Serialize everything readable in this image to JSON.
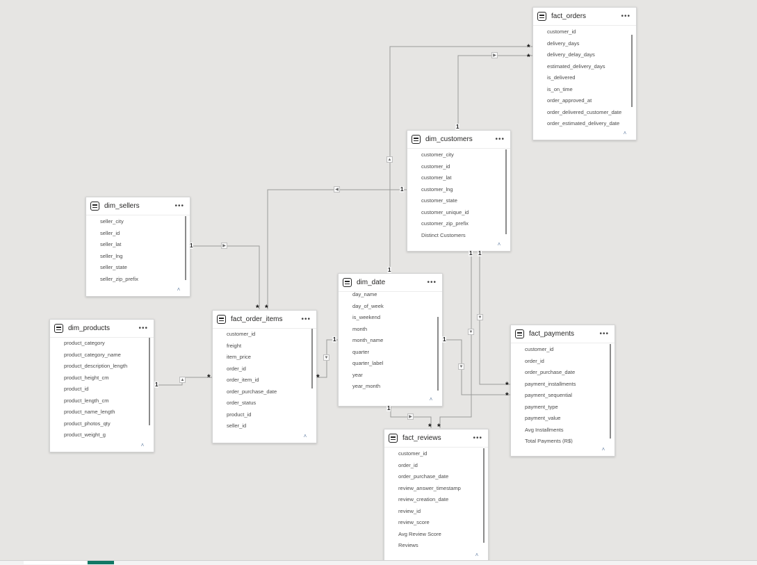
{
  "tables": [
    {
      "id": "fact_orders",
      "title": "fact_orders",
      "fields": [
        "customer_id",
        "delivery_days",
        "delivery_delay_days",
        "estimated_delivery_days",
        "is_delivered",
        "is_on_time",
        "order_approved_at",
        "order_delivered_customer_date",
        "order_estimated_delivery_date"
      ]
    },
    {
      "id": "dim_customers",
      "title": "dim_customers",
      "fields": [
        "customer_city",
        "customer_id",
        "customer_lat",
        "customer_lng",
        "customer_state",
        "customer_unique_id",
        "customer_zip_prefix",
        "Distinct Customers"
      ]
    },
    {
      "id": "dim_sellers",
      "title": "dim_sellers",
      "fields": [
        "seller_city",
        "seller_id",
        "seller_lat",
        "seller_lng",
        "seller_state",
        "seller_zip_prefix"
      ]
    },
    {
      "id": "dim_date",
      "title": "dim_date",
      "fields": [
        "day_name",
        "day_of_week",
        "is_weekend",
        "month",
        "month_name",
        "quarter",
        "quarter_label",
        "year",
        "year_month"
      ]
    },
    {
      "id": "fact_order_items",
      "title": "fact_order_items",
      "fields": [
        "customer_id",
        "freight",
        "item_price",
        "order_id",
        "order_item_id",
        "order_purchase_date",
        "order_status",
        "product_id",
        "seller_id"
      ]
    },
    {
      "id": "dim_products",
      "title": "dim_products",
      "fields": [
        "product_category",
        "product_category_name",
        "product_description_length",
        "product_height_cm",
        "product_id",
        "product_length_cm",
        "product_name_length",
        "product_photos_qty",
        "product_weight_g"
      ]
    },
    {
      "id": "fact_payments",
      "title": "fact_payments",
      "fields": [
        "customer_id",
        "order_id",
        "order_purchase_date",
        "payment_installments",
        "payment_sequential",
        "payment_type",
        "payment_value",
        "Avg Installments",
        "Total Payments (R$)"
      ]
    },
    {
      "id": "fact_reviews",
      "title": "fact_reviews",
      "fields": [
        "customer_id",
        "order_id",
        "order_purchase_date",
        "review_answer_timestamp",
        "review_creation_date",
        "review_id",
        "review_score",
        "Avg Review Score",
        "Reviews"
      ]
    }
  ],
  "labels": {
    "one": "1",
    "many": "*"
  },
  "icons": {
    "table": "table-icon",
    "more": "more-options-icon",
    "collapse": "chevron-up-icon",
    "direction": "filter-direction-arrow-icon"
  },
  "colors": {
    "canvas": "#e6e5e3",
    "card": "#ffffff",
    "line": "#9a9a9a",
    "accent": "#117865"
  }
}
